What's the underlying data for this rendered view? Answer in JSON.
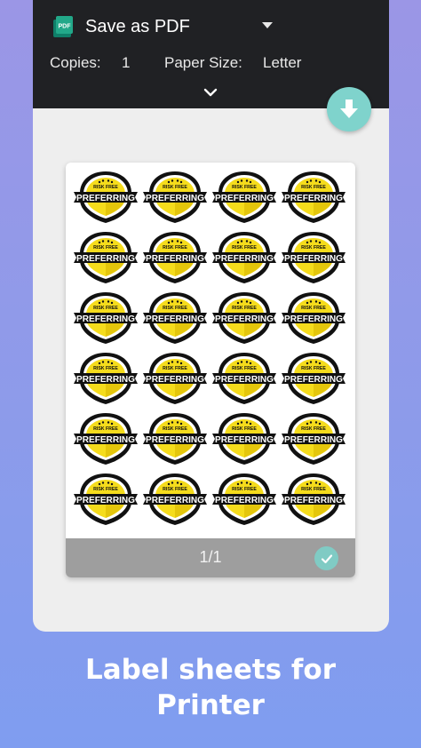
{
  "print_dialog": {
    "destination": "Save as PDF",
    "destination_icon": "pdf-icon",
    "copies_label": "Copies:",
    "copies_value": "1",
    "paper_size_label": "Paper Size:",
    "paper_size_value": "Letter",
    "expand_icon": "chevron-down-icon",
    "download_icon": "download-arrow-icon"
  },
  "preview": {
    "page_counter": "1/1",
    "selected_icon": "check-icon",
    "label_rows": 6,
    "label_columns": 4,
    "label_top_text": "RISK FREE",
    "label_main_text": "PREFERRING"
  },
  "caption": {
    "line1": "Label sheets for",
    "line2": "Printer"
  },
  "colors": {
    "header_bg": "#202124",
    "fab": "#7fd3cc",
    "badge_yellow": "#f5dc1c",
    "badge_black": "#111111",
    "footer_bg": "#9e9e9e"
  }
}
